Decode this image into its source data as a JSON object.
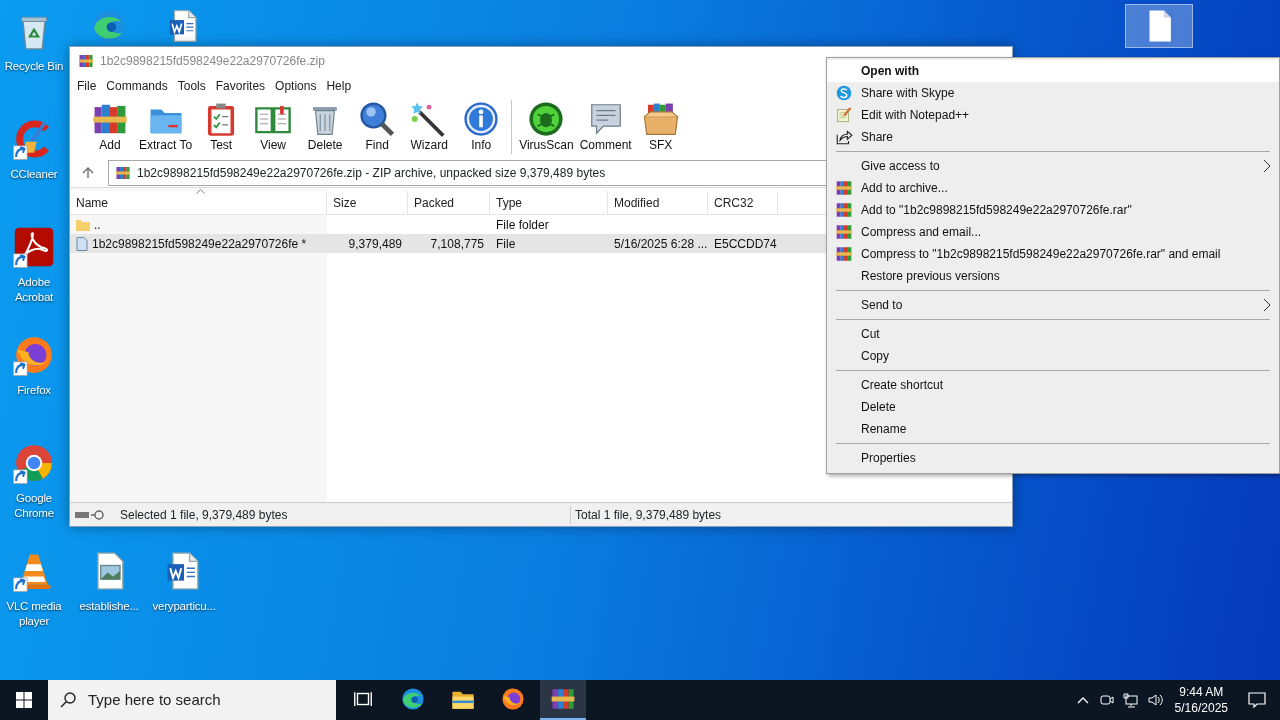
{
  "desktop_icons": [
    {
      "kind": "recycle",
      "label": "Recycle Bin",
      "shortcut": false,
      "selected": false
    },
    {
      "kind": "edge",
      "shortcut": false,
      "selected": false
    },
    {
      "kind": "word",
      "shortcut": false,
      "selected": false
    },
    {
      "kind": "ccleaner",
      "label": "CCleaner",
      "shortcut": true,
      "selected": false
    },
    {
      "kind": "acrobat",
      "label": "Adobe Acrobat",
      "shortcut": true,
      "selected": false
    },
    {
      "kind": "firefox",
      "label": "Firefox",
      "shortcut": true,
      "selected": false
    },
    {
      "kind": "chrome",
      "label": "Google Chrome",
      "shortcut": true,
      "selected": false
    },
    {
      "kind": "vlc",
      "label": "VLC media player",
      "shortcut": true,
      "selected": false
    },
    {
      "kind": "image",
      "label": "establishe...",
      "shortcut": false,
      "selected": false
    },
    {
      "kind": "word",
      "label": "veryparticu...",
      "shortcut": false,
      "selected": false
    },
    {
      "kind": "file",
      "shortcut": false,
      "selected": true
    }
  ],
  "window": {
    "title": "1b2c9898215fd598249e22a2970726fe.zip",
    "menu": [
      "File",
      "Commands",
      "Tools",
      "Favorites",
      "Options",
      "Help"
    ],
    "toolbar": [
      [
        {
          "kind": "add",
          "label": "Add"
        },
        {
          "kind": "extract",
          "label": "Extract To"
        },
        {
          "kind": "test",
          "label": "Test"
        },
        {
          "kind": "view",
          "label": "View"
        },
        {
          "kind": "delete",
          "label": "Delete"
        },
        {
          "kind": "find",
          "label": "Find"
        },
        {
          "kind": "wizard",
          "label": "Wizard"
        },
        {
          "kind": "info",
          "label": "Info"
        }
      ],
      [
        {
          "kind": "virusscan",
          "label": "VirusScan"
        },
        {
          "kind": "comment",
          "label": "Comment"
        },
        {
          "kind": "sfx",
          "label": "SFX"
        }
      ]
    ],
    "address": "1b2c9898215fd598249e22a2970726fe.zip - ZIP archive, unpacked size 9,379,489 bytes",
    "columns": [
      "Name",
      "Size",
      "Packed",
      "Type",
      "Modified",
      "CRC32"
    ],
    "rows": [
      {
        "kind": "folder",
        "name": "..",
        "type": "File folder",
        "selected": false
      },
      {
        "kind": "file",
        "name": "1b2c9898215fd598249e22a2970726fe *",
        "size": "9,379,489",
        "packed": "7,108,775",
        "type": "File",
        "modified": "5/16/2025 6:28 ...",
        "crc32": "E5CCDD74",
        "selected": true
      }
    ],
    "status_left": "Selected 1 file, 9,379,489 bytes",
    "status_right": "Total 1 file, 9,379,489 bytes"
  },
  "context_menu": {
    "sections": [
      [
        {
          "label": "Open with",
          "default": true,
          "submenu": false,
          "selected": true
        },
        {
          "kind": "skype",
          "label": "Share with Skype",
          "default": false,
          "submenu": false,
          "selected": false
        },
        {
          "kind": "notepad",
          "label": "Edit with Notepad++",
          "default": false,
          "submenu": false,
          "selected": false
        },
        {
          "kind": "share",
          "label": "Share",
          "default": false,
          "submenu": false,
          "selected": false
        }
      ],
      [
        {
          "label": "Give access to",
          "default": false,
          "submenu": true,
          "selected": false
        },
        {
          "kind": "rar",
          "label": "Add to archive...",
          "default": false,
          "submenu": false,
          "selected": false
        },
        {
          "kind": "rar",
          "label": "Add to \"1b2c9898215fd598249e22a2970726fe.rar\"",
          "default": false,
          "submenu": false,
          "selected": false
        },
        {
          "kind": "rar",
          "label": "Compress and email...",
          "default": false,
          "submenu": false,
          "selected": false
        },
        {
          "kind": "rar",
          "label": "Compress to \"1b2c9898215fd598249e22a2970726fe.rar\" and email",
          "default": false,
          "submenu": false,
          "selected": false
        },
        {
          "label": "Restore previous versions",
          "default": false,
          "submenu": false,
          "selected": false
        }
      ],
      [
        {
          "label": "Send to",
          "default": false,
          "submenu": true,
          "selected": false
        }
      ],
      [
        {
          "label": "Cut",
          "default": false,
          "submenu": false,
          "selected": false
        },
        {
          "label": "Copy",
          "default": false,
          "submenu": false,
          "selected": false
        }
      ],
      [
        {
          "label": "Create shortcut",
          "default": false,
          "submenu": false,
          "selected": false
        },
        {
          "label": "Delete",
          "default": false,
          "submenu": false,
          "selected": false
        },
        {
          "label": "Rename",
          "default": false,
          "submenu": false,
          "selected": false
        }
      ],
      [
        {
          "label": "Properties",
          "default": false,
          "submenu": false,
          "selected": false
        }
      ]
    ]
  },
  "taskbar": {
    "search_placeholder": "Type here to search",
    "apps": [
      {
        "kind": "taskview",
        "active": false
      },
      {
        "kind": "edge",
        "active": false
      },
      {
        "kind": "explorer",
        "active": false
      },
      {
        "kind": "firefox",
        "active": false
      },
      {
        "kind": "rar",
        "active": true
      }
    ],
    "time": "9:44 AM",
    "date": "5/16/2025"
  }
}
